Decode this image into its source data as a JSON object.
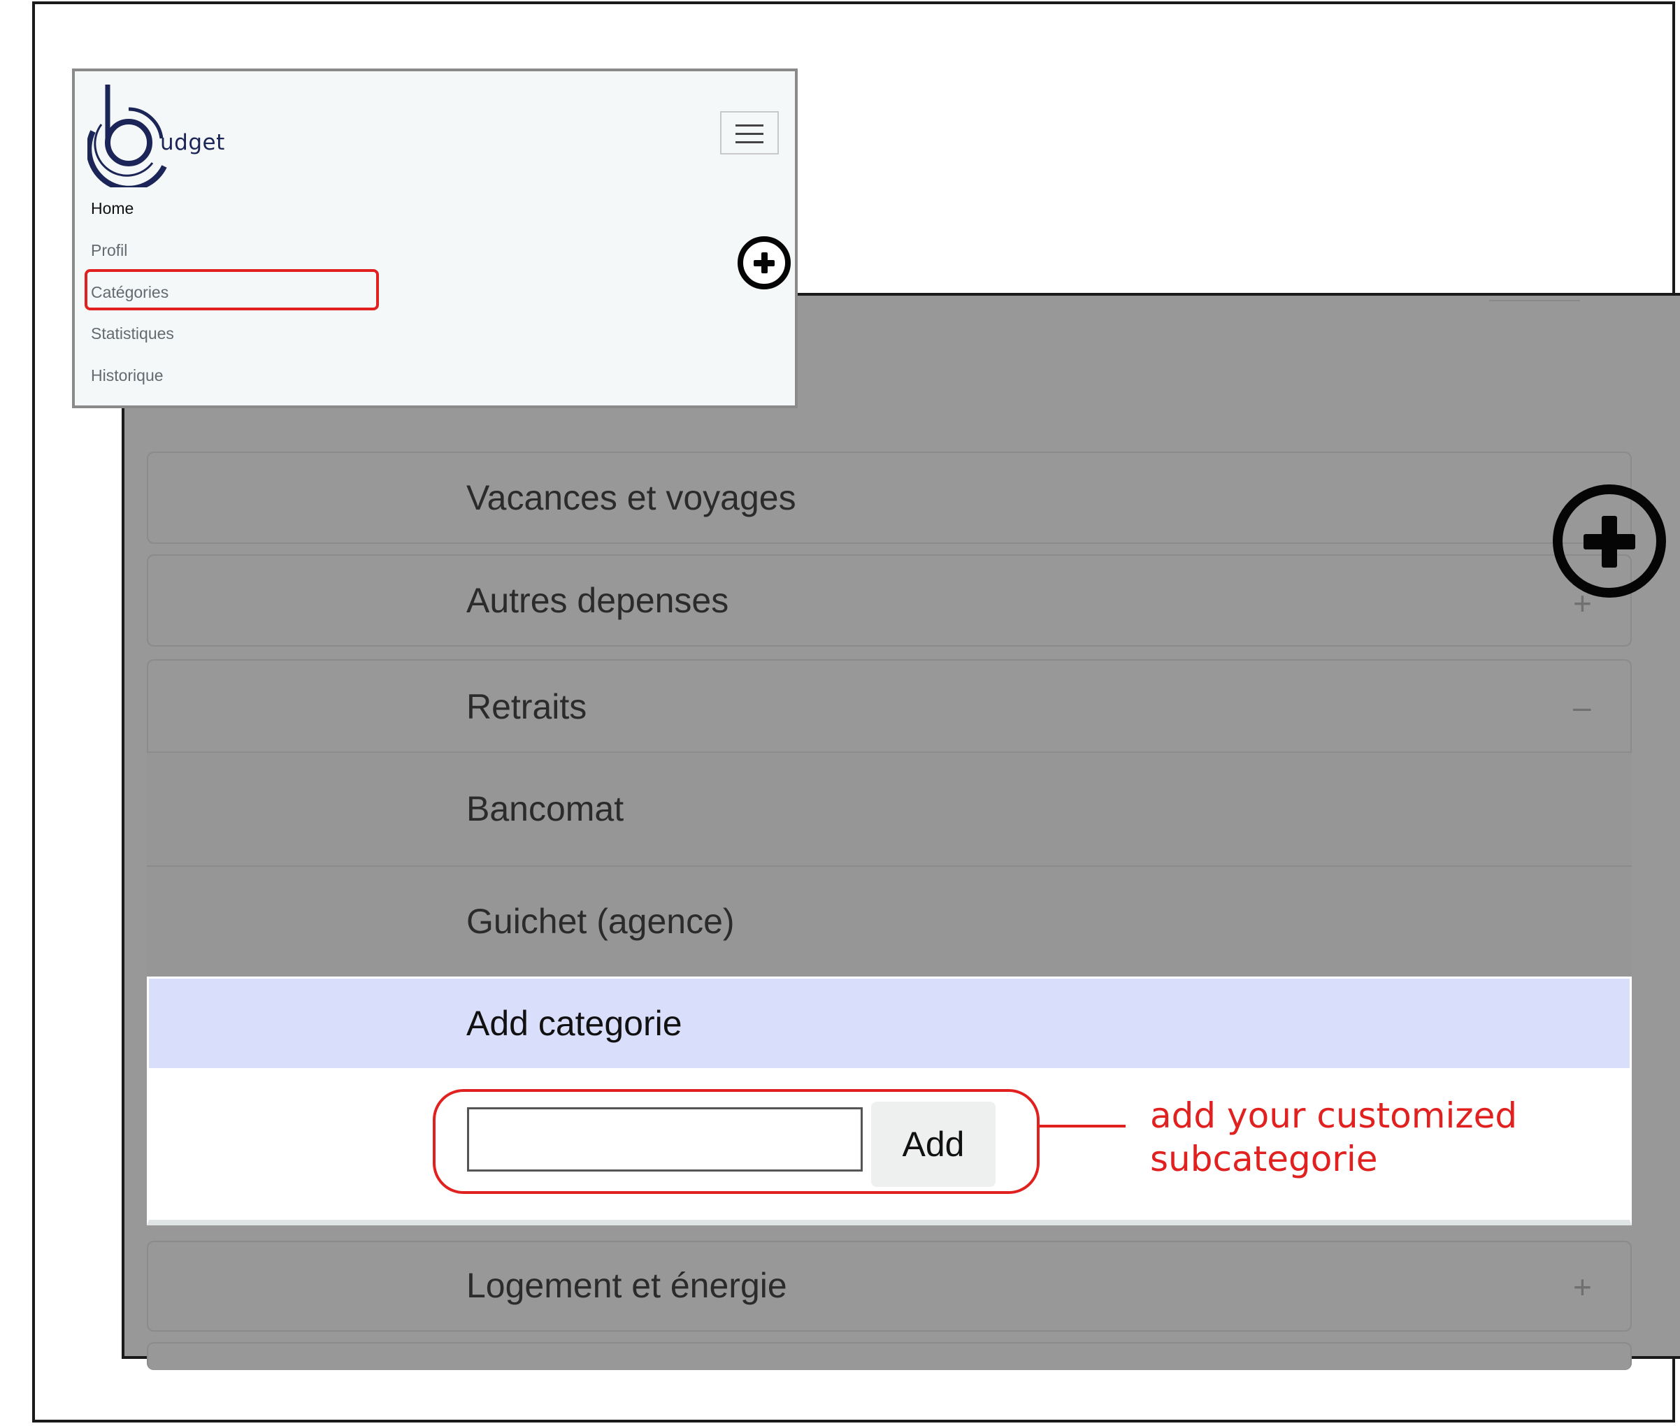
{
  "menu": {
    "logo_letter": "b",
    "logo_text": "udget",
    "items": [
      {
        "label": "Home",
        "active": true
      },
      {
        "label": "Profil",
        "active": false
      },
      {
        "label": "Catégories",
        "active": false,
        "highlighted": true
      },
      {
        "label": "Statistiques",
        "active": false
      },
      {
        "label": "Historique",
        "active": false
      }
    ]
  },
  "categories": {
    "collapsed_sign": "+",
    "expanded_sign": "–",
    "vacances": "Vacances et voyages",
    "autres": "Autres depenses",
    "retraits": "Retraits",
    "logement": "Logement et énergie",
    "retraits_subcategories": [
      "Bancomat",
      "Guichet (agence)"
    ]
  },
  "add_category": {
    "header": "Add categorie",
    "input_value": "",
    "button_label": "Add"
  },
  "annotation": {
    "line1": "add your customized",
    "line2": "subcategorie"
  },
  "colors": {
    "annotation_red": "#e0211f",
    "overlay_gray": "#979897",
    "add_header_bg": "#d9dffb",
    "logo_navy": "#1b2557"
  },
  "icons": {
    "add_category_fab": "plus-circle-icon",
    "menu_toggle": "hamburger-icon"
  }
}
